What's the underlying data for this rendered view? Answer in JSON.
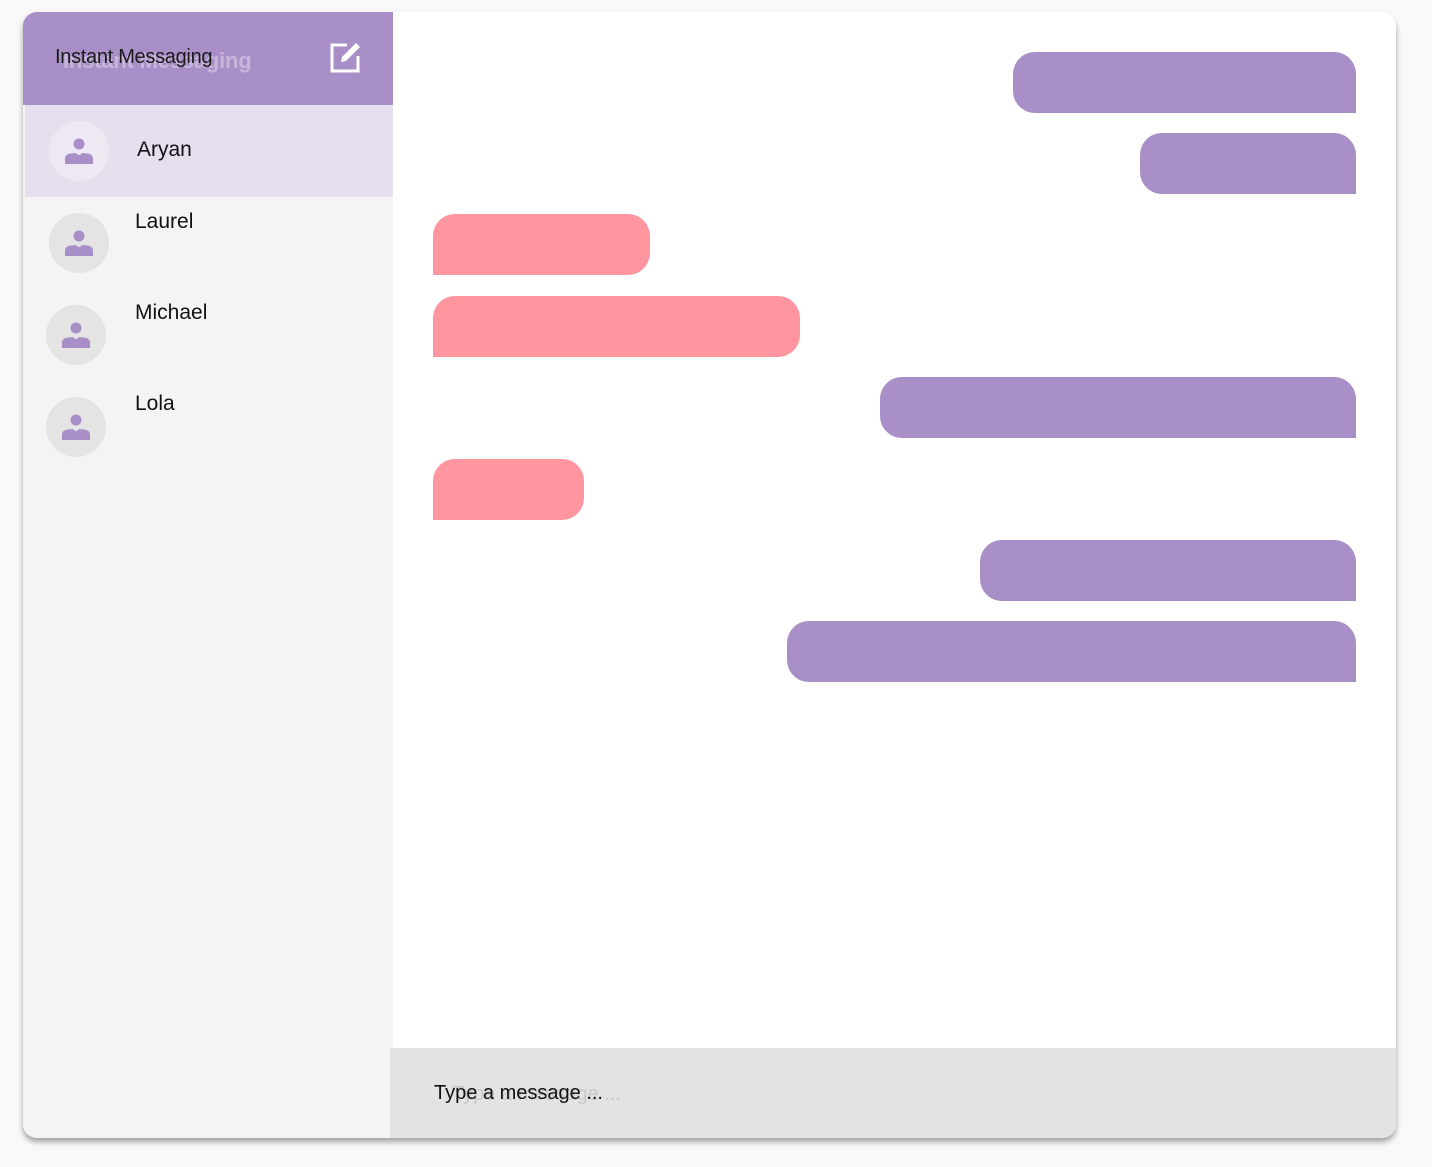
{
  "app": {
    "title": "Instant Messaging",
    "accent_color": "#a98fc8",
    "received_color": "#ff959f"
  },
  "sidebar": {
    "compose_icon": "compose-icon",
    "contacts": [
      {
        "name": "Aryan",
        "avatar_icon": "person-icon",
        "selected": true
      },
      {
        "name": "Laurel",
        "avatar_icon": "person-icon",
        "selected": false
      },
      {
        "name": "Michael",
        "avatar_icon": "person-icon",
        "selected": false
      },
      {
        "name": "Lola",
        "avatar_icon": "person-icon",
        "selected": false
      }
    ]
  },
  "chat": {
    "messages": [
      {
        "direction": "sent",
        "text": ""
      },
      {
        "direction": "sent",
        "text": ""
      },
      {
        "direction": "received",
        "text": ""
      },
      {
        "direction": "received",
        "text": ""
      },
      {
        "direction": "sent",
        "text": ""
      },
      {
        "direction": "received",
        "text": ""
      },
      {
        "direction": "sent",
        "text": ""
      },
      {
        "direction": "sent",
        "text": ""
      }
    ]
  },
  "composer": {
    "placeholder": "Type a message ...",
    "value": ""
  }
}
